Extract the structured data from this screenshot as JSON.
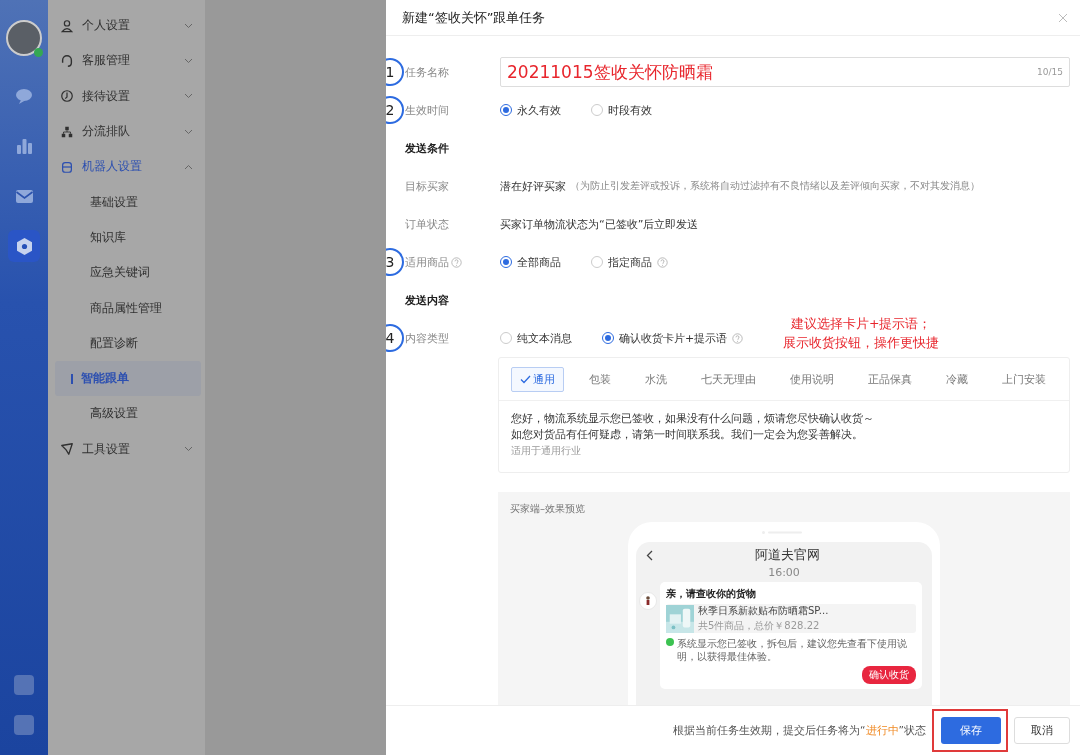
{
  "rail": {
    "avatar": {
      "online": true
    },
    "items": [
      {
        "selected": false
      },
      {
        "selected": false
      },
      {
        "selected": false
      },
      {
        "selected": true
      }
    ]
  },
  "sidebar": {
    "items": [
      {
        "label": "个人设置",
        "expanded": false
      },
      {
        "label": "客服管理",
        "expanded": false
      },
      {
        "label": "接待设置",
        "expanded": false
      },
      {
        "label": "分流排队",
        "expanded": false
      },
      {
        "label": "机器人设置",
        "expanded": true,
        "children": [
          {
            "label": "基础设置",
            "selected": false
          },
          {
            "label": "知识库",
            "selected": false
          },
          {
            "label": "应急关键词",
            "selected": false
          },
          {
            "label": "商品属性管理",
            "selected": false
          },
          {
            "label": "配置诊断",
            "selected": false
          },
          {
            "label": "智能跟单",
            "selected": true
          },
          {
            "label": "高级设置",
            "selected": false
          }
        ]
      },
      {
        "label": "工具设置",
        "expanded": false
      }
    ]
  },
  "dialog": {
    "title": "新建“签收关怀”跟单任务",
    "rows": [
      {
        "kind": "input",
        "label": "任务名称",
        "step": "1",
        "value": "20211015签收关怀防晒霜",
        "counter": "10/15"
      },
      {
        "kind": "radio",
        "label": "生效时间",
        "step": "2",
        "options": [
          {
            "label": "永久有效",
            "selected": true
          },
          {
            "label": "时段有效",
            "selected": false
          }
        ]
      },
      {
        "kind": "section",
        "label": "发送条件"
      },
      {
        "kind": "text",
        "label": "目标买家",
        "value": "潜在好评买家",
        "note": "（为防止引发差评或投诉，系统将自动过滤掉有不良情绪以及差评倾向买家，不对其发消息）"
      },
      {
        "kind": "text",
        "label": "订单状态",
        "value": "买家订单物流状态为“已签收”后立即发送"
      },
      {
        "kind": "radio",
        "label": "适用商品",
        "step": "3",
        "help": true,
        "options": [
          {
            "label": "全部商品",
            "selected": true
          },
          {
            "label": "指定商品",
            "selected": false,
            "help": true
          }
        ]
      },
      {
        "kind": "section",
        "label": "发送内容"
      },
      {
        "kind": "radio",
        "label": "内容类型",
        "step": "4",
        "options": [
          {
            "label": "纯文本消息",
            "selected": false
          },
          {
            "label": "确认收货卡片+提示语",
            "selected": true,
            "help": true
          }
        ],
        "annotation": [
          "建议选择卡片+提示语；",
          "展示收货按钮，操作更快捷"
        ]
      }
    ],
    "templates": {
      "tabs": [
        {
          "label": "通用",
          "selected": true
        },
        {
          "label": "包装",
          "selected": false
        },
        {
          "label": "水洗",
          "selected": false
        },
        {
          "label": "七天无理由",
          "selected": false
        },
        {
          "label": "使用说明",
          "selected": false
        },
        {
          "label": "正品保真",
          "selected": false
        },
        {
          "label": "冷藏",
          "selected": false
        },
        {
          "label": "上门安装",
          "selected": false
        }
      ],
      "message": [
        "您好，物流系统显示您已签收，如果没有什么问题，烦请您尽快确认收货～",
        "如您对货品有任何疑虑，请第一时间联系我。我们一定会为您妥善解决。"
      ],
      "hint": "适用于通用行业"
    },
    "preview": {
      "label": "买家端–效果预览",
      "shop": "阿道夫官网",
      "time": "16:00",
      "card_title": "亲，请查收你的货物",
      "product": "秋季日系新款贴布防晒霜SP...",
      "summary": "共5件商品，总价￥828.22",
      "notice": "系统显示您已签收，拆包后，建议您先查看下使用说明，以获得最佳体验。",
      "confirm": "确认收货"
    },
    "footer": {
      "note": "根据当前任务生效期，提交后任务将为“**进行中**”状态",
      "save": "保存",
      "cancel": "取消",
      "save_highlighted": true
    }
  }
}
